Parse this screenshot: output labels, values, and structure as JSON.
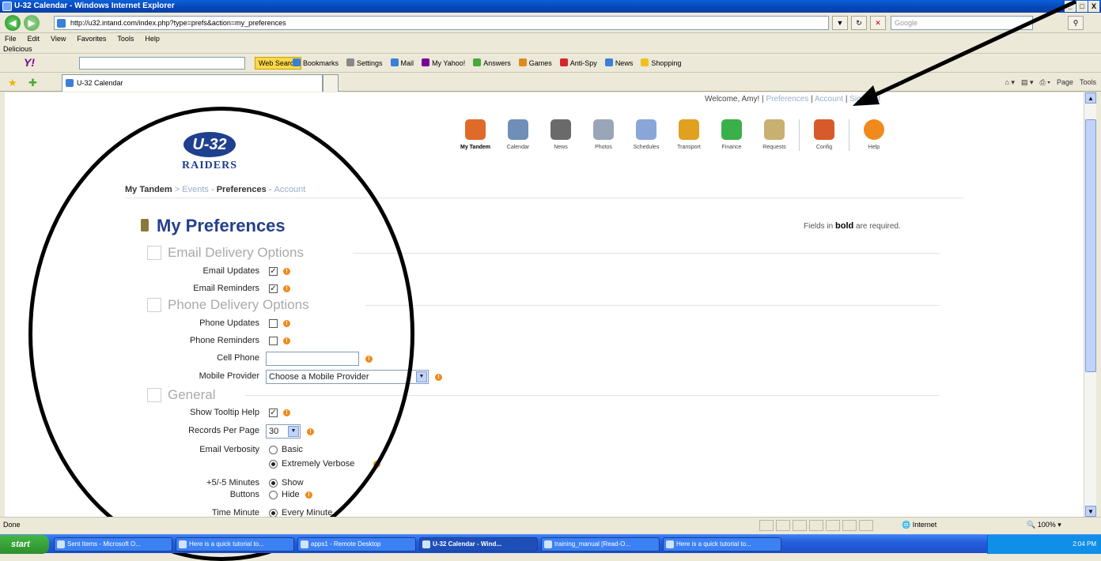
{
  "window": {
    "title": "U-32 Calendar - Windows Internet Explorer",
    "controls": [
      "_",
      "□",
      "X"
    ]
  },
  "address_bar": {
    "url": "http://u32.intand.com/index.php?type=prefs&action=my_preferences",
    "search_placeholder": "Google"
  },
  "menu": [
    "File",
    "Edit",
    "View",
    "Favorites",
    "Tools",
    "Help"
  ],
  "links_bar": {
    "label": "Delicious"
  },
  "yahoo_toolbar": {
    "logo": "Y!",
    "web_search": "Web Search",
    "items": [
      "Bookmarks",
      "Settings",
      "Mail",
      "My Yahoo!",
      "Answers",
      "Games",
      "Anti-Spy",
      "News",
      "Shopping"
    ],
    "colors": [
      "#3a7fd8",
      "#888888",
      "#3a7fd8",
      "#7b0099",
      "#4aa83a",
      "#e08a1c",
      "#d8262a",
      "#3a7fd8",
      "#f0c020"
    ]
  },
  "tab": {
    "label": "U-32 Calendar"
  },
  "command_bar": [
    "Page",
    "Tools"
  ],
  "site": {
    "welcome": "Welcome, Amy!",
    "links": [
      "Preferences",
      "Account",
      "Sign Out"
    ],
    "logo_top": "U-32",
    "logo_bottom": "RAIDERS",
    "nav": [
      {
        "label": "My Tandem",
        "icon": "house-icon",
        "color": "#e06a2a"
      },
      {
        "label": "Calendar",
        "icon": "calendar-icon",
        "color": "#6f8fb8"
      },
      {
        "label": "News",
        "icon": "news-icon",
        "color": "#6a6a6a"
      },
      {
        "label": "Photos",
        "icon": "photos-icon",
        "color": "#9aa6b8"
      },
      {
        "label": "Schedules",
        "icon": "schedules-icon",
        "color": "#8aa6d8"
      },
      {
        "label": "Transport",
        "icon": "bus-icon",
        "color": "#e0a020"
      },
      {
        "label": "Finance",
        "icon": "finance-icon",
        "color": "#3ab04a"
      },
      {
        "label": "Requests",
        "icon": "requests-icon",
        "color": "#c8b070"
      },
      {
        "label": "Config",
        "icon": "config-icon",
        "color": "#d85a2a"
      },
      {
        "label": "Help",
        "icon": "help-icon",
        "color": "#f08a1c"
      }
    ],
    "breadcrumb": {
      "home": "My Tandem",
      "sep": ">",
      "events": "Events",
      "dash": "-",
      "current": "Preferences",
      "account": "Account"
    },
    "page_title": "My Preferences",
    "required_prefix": "Fields in",
    "required_bold": "bold",
    "required_suffix": "are required."
  },
  "form": {
    "email_section": "Email Delivery Options",
    "email_updates": {
      "label": "Email Updates",
      "checked": true
    },
    "email_reminders": {
      "label": "Email Reminders",
      "checked": true
    },
    "phone_section": "Phone Delivery Options",
    "phone_updates": {
      "label": "Phone Updates",
      "checked": false
    },
    "phone_reminders": {
      "label": "Phone Reminders",
      "checked": false
    },
    "cell_phone": {
      "label": "Cell Phone",
      "value": ""
    },
    "mobile_provider": {
      "label": "Mobile Provider",
      "value": "Choose a Mobile Provider"
    },
    "general_section": "General",
    "show_tooltip": {
      "label": "Show Tooltip Help",
      "checked": true
    },
    "records_per_page": {
      "label": "Records Per Page",
      "value": "30"
    },
    "email_verbosity": {
      "label": "Email Verbosity",
      "options": [
        "Basic",
        "Extremely Verbose"
      ],
      "selected": "Extremely Verbose"
    },
    "minutes_buttons": {
      "label_1": "+5/-5 Minutes",
      "label_2": "Buttons",
      "options": [
        "Show",
        "Hide"
      ],
      "selected": "Show"
    },
    "time_minute": {
      "label": "Time Minute",
      "options": [
        "Every Minute"
      ],
      "selected": "Every Minute"
    }
  },
  "status": {
    "text": "Done",
    "zone": "Internet",
    "zoom": "100%"
  },
  "taskbar": {
    "start": "start",
    "tasks": [
      "Sent Items - Microsoft O...",
      "Here is a quick tutorial to...",
      "apps1 - Remote Desktop",
      "U-32 Calendar - Wind...",
      "training_manual [Read-O...",
      "Here is a quick tutorial to..."
    ],
    "clock": "2:04 PM"
  }
}
